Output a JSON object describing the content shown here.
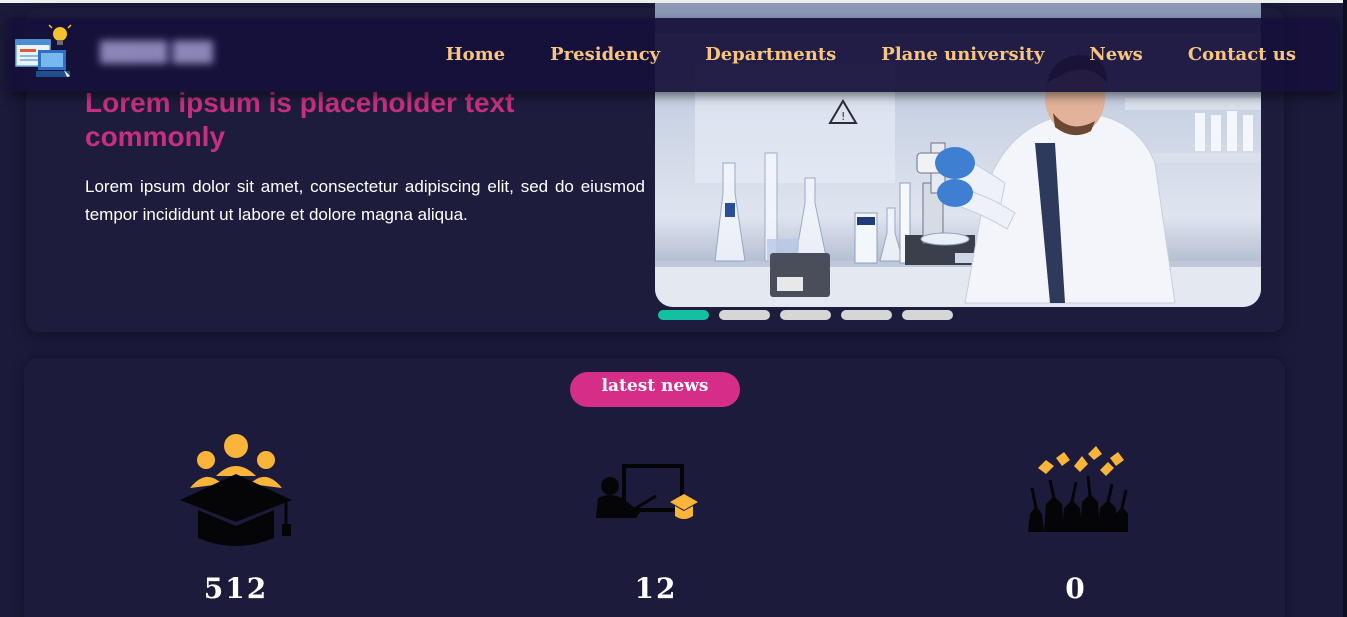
{
  "navbar": {
    "links": [
      "Home",
      "Presidency",
      "Departments",
      "Plane university",
      "News",
      "Contact us"
    ]
  },
  "hero": {
    "title": "Lorem ipsum is placeholder text commonly",
    "text": "Lorem ipsum dolor sit amet, consectetur adipiscing elit, sed do eiusmod tempor incididunt ut labore et dolore magna aliqua.",
    "slider_total": 5,
    "slider_active": 1
  },
  "news": {
    "badge": "latest news"
  },
  "stats": [
    {
      "icon": "students-graduation-cap-icon",
      "value": "512"
    },
    {
      "icon": "teacher-board-icon",
      "value": "12"
    },
    {
      "icon": "graduates-celebrating-icon",
      "value": "0"
    }
  ],
  "colors": {
    "background": "#1b1a3a",
    "nav_link": "#f7c57f",
    "title": "#c8307f",
    "badge": "#d42e88",
    "slider_active": "#13c1a0",
    "icon_accent": "#f9b43a"
  }
}
